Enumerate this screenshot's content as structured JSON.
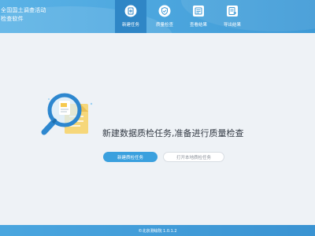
{
  "app": {
    "title_line1": "全国国土调查活动",
    "title_line2": "检查软件"
  },
  "nav": {
    "items": [
      {
        "label": "新建任务",
        "icon": "document-plus-icon",
        "active": true
      },
      {
        "label": "质量检查",
        "icon": "shield-check-icon",
        "active": false
      },
      {
        "label": "查看结果",
        "icon": "list-view-icon",
        "active": false
      },
      {
        "label": "导出结果",
        "icon": "export-document-icon",
        "active": false
      }
    ]
  },
  "main": {
    "headline": "新建数据质检任务,准备进行质量检查",
    "primary_button": "新建质检任务",
    "secondary_button": "打开本地质检任务"
  },
  "footer": {
    "version_text": "©北京测绘院 1.0.1.2"
  },
  "colors": {
    "header": "#4aa6df",
    "nav_active": "#2f86c6",
    "primary": "#3aa0de",
    "background": "#eef2f6"
  }
}
